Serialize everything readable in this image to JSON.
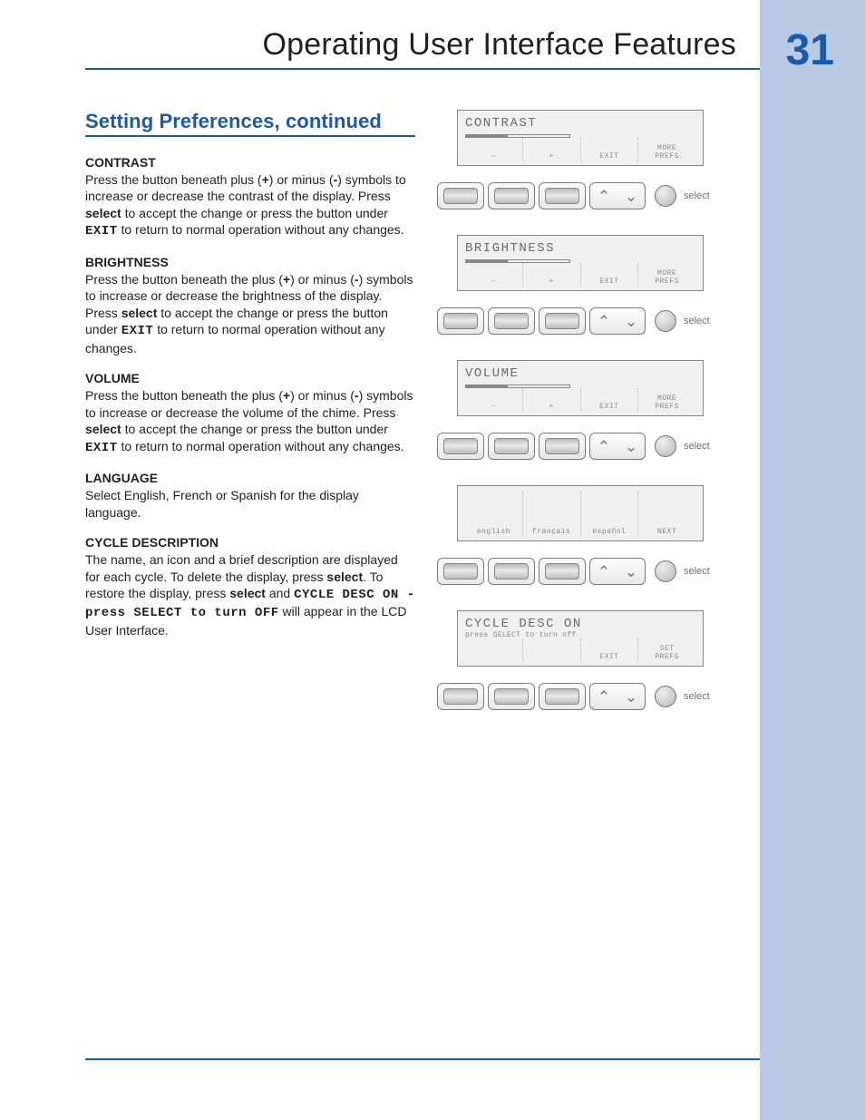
{
  "page": {
    "title": "Operating User Interface Features",
    "number": "31",
    "section_heading": "Setting Preferences, continued"
  },
  "sections": {
    "contrast": {
      "heading": "CONTRAST",
      "pre": "Press the button beneath plus (",
      "plus": "+",
      "mid1": ") or minus (",
      "minus": "-",
      "mid2": ") symbols to increase or decrease the contrast of the display. Press ",
      "select": "select",
      "mid3": " to accept the change or press the button under ",
      "exit": "EXIT",
      "post": " to return to normal operation without any changes."
    },
    "brightness": {
      "heading": "BRIGHTNESS",
      "pre": "Press the button beneath the plus (",
      "plus": "+",
      "mid1": ") or minus (",
      "minus": "-",
      "mid2": ") symbols to increase or decrease the brightness of the display. Press ",
      "select": "select",
      "mid3": " to accept the change or press the button under ",
      "exit": "EXIT",
      "post": " to return to normal operation without any changes."
    },
    "volume": {
      "heading": "VOLUME",
      "pre": "Press the button beneath the plus (",
      "plus": "+",
      "mid1": ") or minus (",
      "minus": "-",
      "mid2": ") symbols to increase or decrease the volume of the chime. Press ",
      "select": "select",
      "mid3": " to accept the change or press the button under ",
      "exit": "EXIT",
      "post": " to return to normal operation without any changes."
    },
    "language": {
      "heading": "LANGUAGE",
      "body": "Select English, French or Spanish for the display language."
    },
    "cycle": {
      "heading": "CYCLE DESCRIPTION",
      "pre": "The name, an icon and a brief description are displayed for each cycle. To delete the display, press ",
      "select1": "select",
      "mid1": ". To restore the display, press ",
      "select2": "select",
      "mid2": " and ",
      "lcd_string": "CYCLE DESC ON - press SELECT to turn OFF",
      "post": " will appear in the LCD User Interface."
    }
  },
  "lcd": {
    "contrast": {
      "title": "CONTRAST",
      "k1": "–",
      "k2": "+",
      "k3": "EXIT",
      "k4a": "MORE",
      "k4b": "PREFS"
    },
    "brightness": {
      "title": "BRIGHTNESS",
      "k1": "–",
      "k2": "+",
      "k3": "EXIT",
      "k4a": "MORE",
      "k4b": "PREFS"
    },
    "volume": {
      "title": "VOLUME",
      "k1": "–",
      "k2": "+",
      "k3": "EXIT",
      "k4a": "MORE",
      "k4b": "PREFS"
    },
    "language": {
      "k1": "english",
      "k2": "français",
      "k3": "español",
      "k4": "NEXT"
    },
    "cycle": {
      "title": "CYCLE DESC  ON",
      "sub": "press SELECT to turn off",
      "k3": "EXIT",
      "k4a": "SET",
      "k4b": "PREFS"
    }
  },
  "buttons": {
    "select_label": "select",
    "up": "⌃",
    "down": "⌄"
  }
}
